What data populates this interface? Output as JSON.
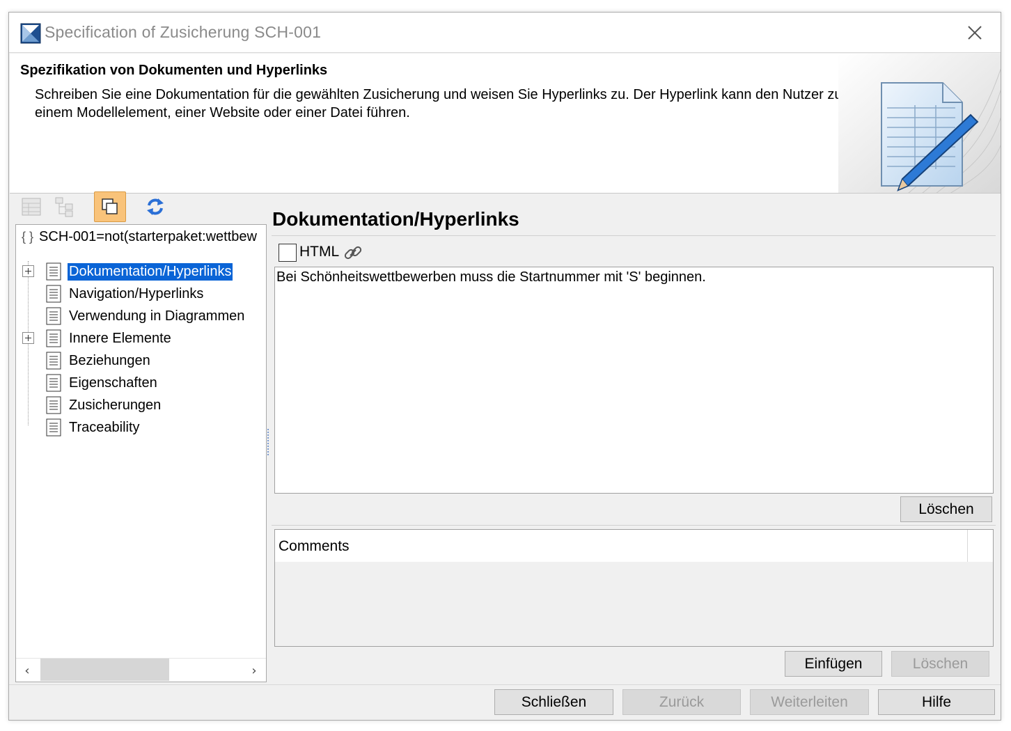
{
  "window": {
    "title": "Specification of Zusicherung SCH-001",
    "close_icon": "close-icon"
  },
  "header": {
    "title": "Spezifikation von Dokumenten und Hyperlinks",
    "description": "Schreiben Sie eine Dokumentation für die gewählten Zusicherung und weisen Sie Hyperlinks zu. Der Hyperlink kann den Nutzer zu einem Modellelement, einer Website oder einer Datei führen."
  },
  "toolbar": {
    "icons": [
      "table-view-icon",
      "tree-view-icon",
      "duplicate-icon",
      "refresh-icon"
    ],
    "active_color": "#f9c37a"
  },
  "tree": {
    "root": "SCH-001=not(starterpaket:wettbew",
    "items": [
      {
        "label": "Dokumentation/Hyperlinks",
        "selected": true,
        "expandable": true
      },
      {
        "label": "Navigation/Hyperlinks",
        "selected": false,
        "expandable": false
      },
      {
        "label": "Verwendung in Diagrammen",
        "selected": false,
        "expandable": false
      },
      {
        "label": "Innere Elemente",
        "selected": false,
        "expandable": true
      },
      {
        "label": "Beziehungen",
        "selected": false,
        "expandable": false
      },
      {
        "label": "Eigenschaften",
        "selected": false,
        "expandable": false
      },
      {
        "label": "Zusicherungen",
        "selected": false,
        "expandable": false
      },
      {
        "label": "Traceability",
        "selected": false,
        "expandable": false
      }
    ],
    "selection_color": "#0a64d6"
  },
  "pane": {
    "title": "Dokumentation/Hyperlinks",
    "html_label": "HTML",
    "html_checked": false,
    "documentation_text": "Bei Schönheitswettbewerben muss die Startnummer mit 'S' beginnen.",
    "clear_label": "Löschen",
    "comments_header": "Comments",
    "insert_label": "Einfügen",
    "comments_clear_label": "Löschen"
  },
  "footer": {
    "close_label": "Schließen",
    "back_label": "Zurück",
    "forward_label": "Weiterleiten",
    "help_label": "Hilfe"
  }
}
